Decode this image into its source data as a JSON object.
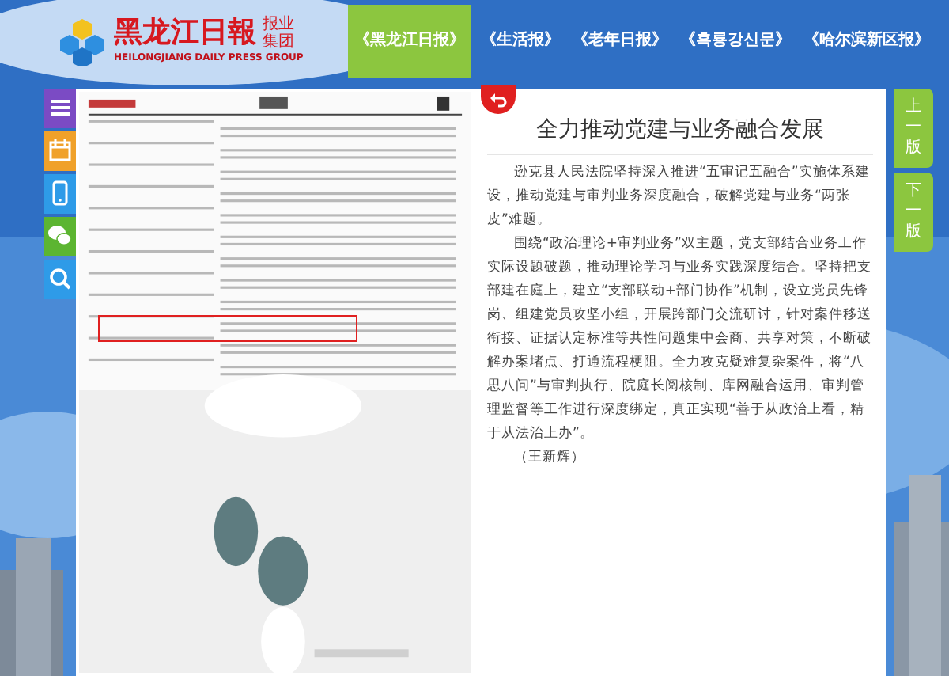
{
  "header": {
    "logo_name": "黑龙江日報",
    "logo_group": "报业集团",
    "logo_english": "HEILONGJIANG DAILY PRESS GROUP"
  },
  "papers": [
    {
      "label": "《黑龙江日报》",
      "selected": true
    },
    {
      "label": "《生活报》",
      "selected": false
    },
    {
      "label": "《老年日报》",
      "selected": false
    },
    {
      "label": "《흑룡강신문》",
      "selected": false
    },
    {
      "label": "《哈尔滨新区报》",
      "selected": false
    }
  ],
  "sidebar": [
    {
      "kind": "menu"
    },
    {
      "kind": "calendar"
    },
    {
      "kind": "phone"
    },
    {
      "kind": "wechat"
    },
    {
      "kind": "search"
    }
  ],
  "page_nav": [
    "上一版",
    "下一版"
  ],
  "newspaper_page": {
    "kind": "picture",
    "highlighted": true
  },
  "article": {
    "title": "全力推动党建与业务融合发展",
    "paragraphs": [
      "逊克县人民法院坚持深入推进“五审记五融合”实施体系建设，推动党建与审判业务深度融合，破解党建与业务“两张皮”难题。",
      "围绕“政治理论+审判业务”双主题，党支部结合业务工作实际设题破题，推动理论学习与业务实践深度结合。坚持把支部建在庭上，建立“支部联动+部门协作”机制，设立党员先锋岗、组建党员攻坚小组，开展跨部门交流研讨，针对案件移送衔接、证据认定标准等共性问题集中会商、共享对策，不断破解办案堵点、打通流程梗阻。全力攻克疑难复杂案件，将“八思八问”与审判执行、院庭长阅核制、库网融合运用、审判管理监督等工作进行深度绑定，真正实现“善于从政治上看，精于从法治上办”。"
    ],
    "byline": "（王新辉）"
  }
}
